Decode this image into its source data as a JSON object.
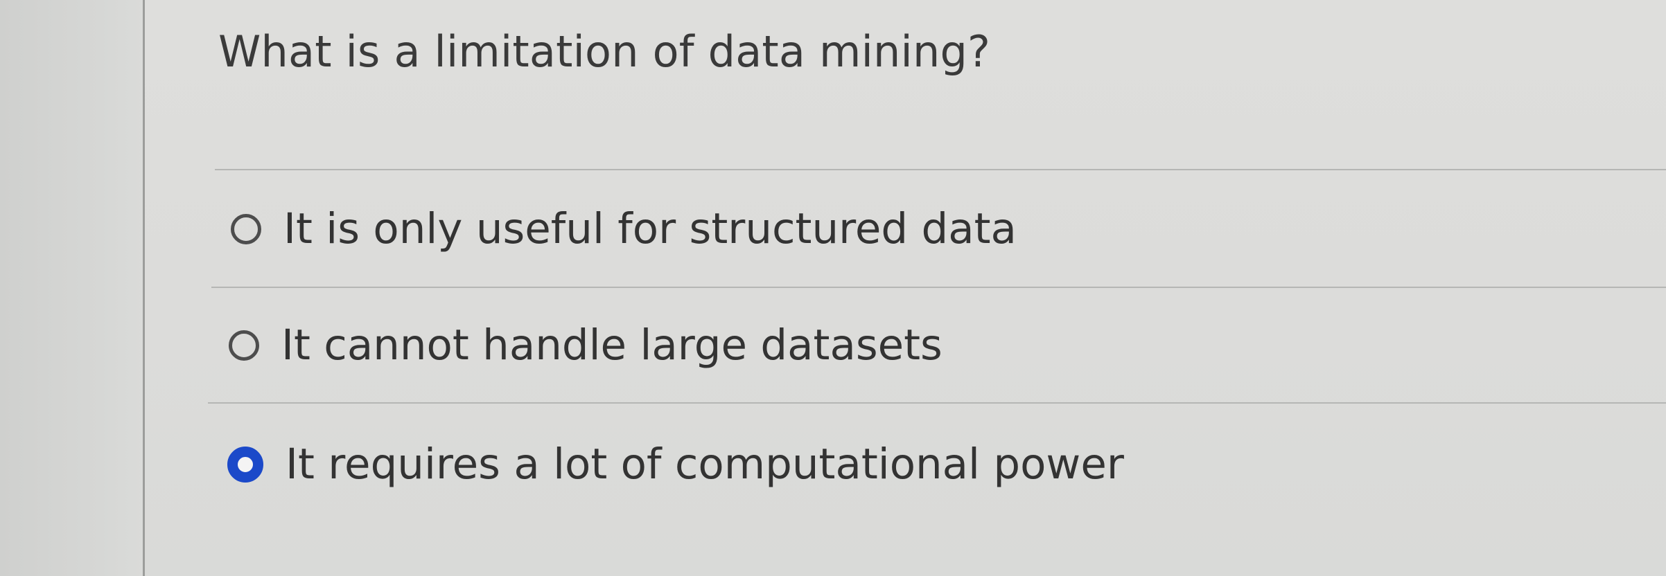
{
  "question": {
    "text": "What is a limitation of data mining?"
  },
  "options": [
    {
      "label": "It is only useful for structured data",
      "selected": false
    },
    {
      "label": "It cannot handle large datasets",
      "selected": false
    },
    {
      "label": "It requires a lot of computational power",
      "selected": true
    }
  ],
  "colors": {
    "selected_radio": "#1b49c9",
    "unselected_radio": "#4d4d4d",
    "text": "#333333",
    "background": "#dcdcda"
  }
}
